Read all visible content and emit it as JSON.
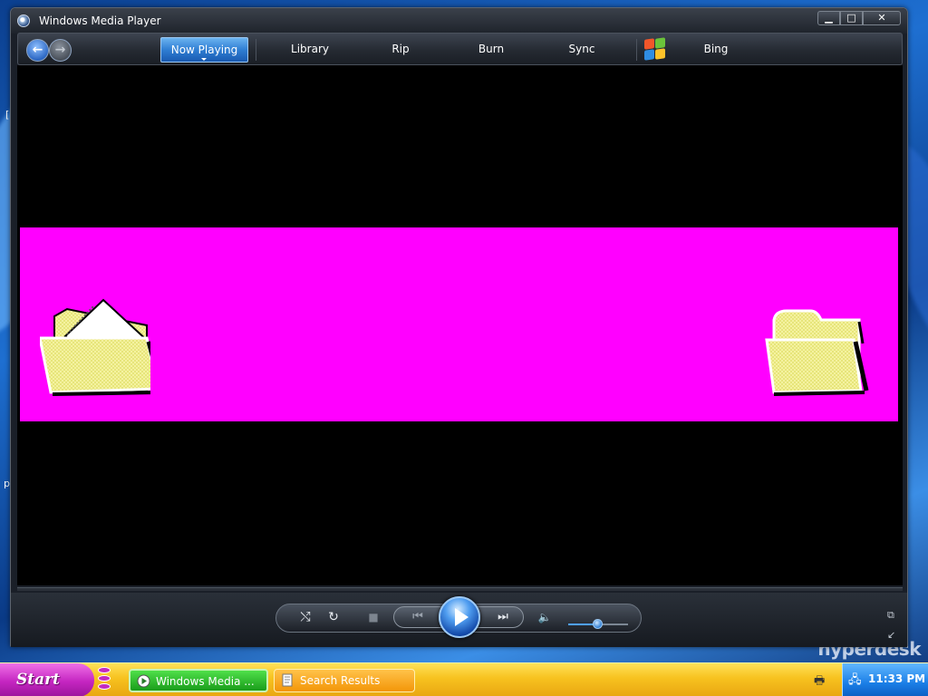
{
  "window": {
    "title": "Windows Media Player",
    "buttons": {
      "minimize": "▁",
      "maximize": "□",
      "close": "✕"
    }
  },
  "nav": {
    "tabs": [
      {
        "label": "Now Playing",
        "active": true
      },
      {
        "label": "Library"
      },
      {
        "label": "Rip"
      },
      {
        "label": "Burn"
      },
      {
        "label": "Sync"
      },
      {
        "label": "Bing"
      }
    ],
    "back_glyph": "←",
    "forward_glyph": "→"
  },
  "video": {
    "background_color": "#000000",
    "band_color": "#ff00ff",
    "icons": [
      "open-folder-icon",
      "folder-icon"
    ]
  },
  "controls": {
    "shuffle_glyph": "⤭",
    "repeat_glyph": "↻",
    "stop_glyph": "■",
    "previous_glyph": "⏮",
    "next_glyph": "⏭",
    "mute_glyph": "🔈",
    "volume_level": 0.5
  },
  "desktop": {
    "watermark": "hyperdesk",
    "left_text_1": "[",
    "left_text_2": "p"
  },
  "taskbar": {
    "start_label": "Start",
    "tasks": [
      {
        "label": "Windows Media ...",
        "active": true
      },
      {
        "label": "Search Results",
        "active": false
      }
    ],
    "clock": "11:33 PM"
  }
}
